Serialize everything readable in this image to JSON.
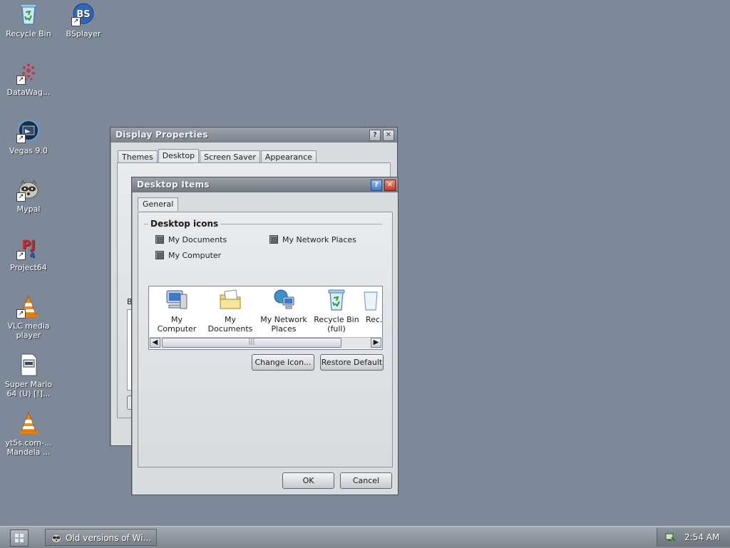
{
  "desktop": {
    "icons": [
      {
        "label": "Recycle Bin",
        "icon": "recycle-bin-icon"
      },
      {
        "label": "BSplayer",
        "icon": "bsplayer-icon"
      },
      {
        "label": "DataWag...",
        "icon": "datawag-icon"
      },
      {
        "label": "Vegas 9.0",
        "icon": "vegas-icon"
      },
      {
        "label": "Mypal",
        "icon": "mypal-raccoon-icon"
      },
      {
        "label": "Project64",
        "icon": "project64-icon"
      },
      {
        "label": "VLC media player",
        "icon": "vlc-cone-icon"
      },
      {
        "label": "Super Mario 64 (U) [!]...",
        "icon": "rom-file-icon"
      },
      {
        "label": "yt5s.com-... Mandela ...",
        "icon": "vlc-cone-icon"
      }
    ]
  },
  "display_properties": {
    "title": "Display Properties",
    "tabs": [
      "Themes",
      "Desktop",
      "Screen Saver",
      "Appearance"
    ],
    "selected_tab": "Desktop",
    "partial_label": "B"
  },
  "desktop_items": {
    "title": "Desktop Items",
    "tabs": [
      "General"
    ],
    "group_title": "Desktop icons",
    "checkboxes": [
      {
        "label": "My Documents",
        "checked": false
      },
      {
        "label": "My Network Places",
        "checked": false
      },
      {
        "label": "My Computer",
        "checked": false
      }
    ],
    "icon_list": [
      {
        "label": "My Computer",
        "icon": "my-computer-icon"
      },
      {
        "label": "My Documents",
        "icon": "my-documents-icon"
      },
      {
        "label": "My Network Places",
        "icon": "network-places-icon"
      },
      {
        "label": "Recycle Bin (full)",
        "icon": "recycle-bin-full-icon"
      },
      {
        "label": "Rec... (...",
        "icon": "recycle-bin-empty-icon"
      }
    ],
    "change_icon_label": "Change Icon...",
    "restore_default_label": "Restore Default",
    "ok_label": "OK",
    "cancel_label": "Cancel"
  },
  "taskbar": {
    "task_label": "Old versions of Wi...",
    "clock": "2:54 AM"
  },
  "colors": {
    "desktop_bg": "#7d8898",
    "window_face": "#d9dcdf",
    "titlebar": "#7b838e"
  }
}
